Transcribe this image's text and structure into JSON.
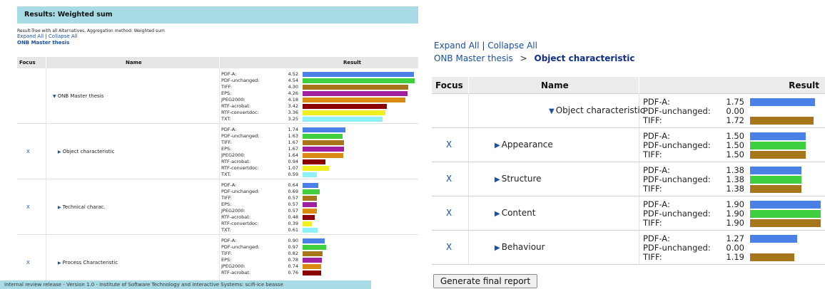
{
  "left": {
    "title": "Results: Weighted sum",
    "subtitle": "Result-Tree with all Alternatives, Aggregation method: Weighted sum",
    "expand_all": "Expand All",
    "link_sep": "|",
    "collapse_all": "Collapse All",
    "breadcrumb": "ONB Master thesis",
    "headers": {
      "focus": "Focus",
      "name": "Name",
      "result": "Result"
    },
    "footer": "Internal review release - Version 1.0 - Institute of Software Technology and Interactive Systems: scifi-ice beasse",
    "rows": [
      {
        "focus": "",
        "name": "ONB Master thesis",
        "expanded": true,
        "results": [
          {
            "label": "PDF-A:",
            "value": "4.52",
            "num": 4.52,
            "color": "#4a80e8"
          },
          {
            "label": "PDF-unchanged:",
            "value": "4.54",
            "num": 4.54,
            "color": "#3fcf3f"
          },
          {
            "label": "TIFF:",
            "value": "4.30",
            "num": 4.3,
            "color": "#a8761a"
          },
          {
            "label": "EPS:",
            "value": "4.26",
            "num": 4.26,
            "color": "#a020a0"
          },
          {
            "label": "JPEG2000:",
            "value": "4.18",
            "num": 4.18,
            "color": "#d98a10"
          },
          {
            "label": "RTF-acrobat:",
            "value": "3.42",
            "num": 3.42,
            "color": "#8b0000"
          },
          {
            "label": "RTF-convertdoc:",
            "value": "3.36",
            "num": 3.36,
            "color": "#f0f020"
          },
          {
            "label": "TXT:",
            "value": "3.25",
            "num": 3.25,
            "color": "#8ef0f8"
          }
        ]
      },
      {
        "focus": "X",
        "name": "Object characteristic",
        "expanded": false,
        "results": [
          {
            "label": "PDF-A:",
            "value": "1.74",
            "num": 1.74,
            "color": "#4a80e8"
          },
          {
            "label": "PDF-unchanged:",
            "value": "1.63",
            "num": 1.63,
            "color": "#3fcf3f"
          },
          {
            "label": "TIFF:",
            "value": "1.67",
            "num": 1.67,
            "color": "#a8761a"
          },
          {
            "label": "EPS:",
            "value": "1.67",
            "num": 1.67,
            "color": "#a020a0"
          },
          {
            "label": "JPEG2000:",
            "value": "1.64",
            "num": 1.64,
            "color": "#d98a10"
          },
          {
            "label": "RTF-acrobat:",
            "value": "0.94",
            "num": 0.94,
            "color": "#8b0000"
          },
          {
            "label": "RTF-convertdoc:",
            "value": "1.07",
            "num": 1.07,
            "color": "#f0f020"
          },
          {
            "label": "TXT:",
            "value": "0.59",
            "num": 0.59,
            "color": "#8ef0f8"
          }
        ]
      },
      {
        "focus": "X",
        "name": "Technical charac.",
        "expanded": false,
        "results": [
          {
            "label": "PDF-A:",
            "value": "0.64",
            "num": 0.64,
            "color": "#4a80e8"
          },
          {
            "label": "PDF-unchanged:",
            "value": "0.69",
            "num": 0.69,
            "color": "#3fcf3f"
          },
          {
            "label": "TIFF:",
            "value": "0.57",
            "num": 0.57,
            "color": "#a8761a"
          },
          {
            "label": "EPS:",
            "value": "0.57",
            "num": 0.57,
            "color": "#a020a0"
          },
          {
            "label": "JPEG2000:",
            "value": "0.57",
            "num": 0.57,
            "color": "#d98a10"
          },
          {
            "label": "RTF-acrobat:",
            "value": "0.48",
            "num": 0.48,
            "color": "#8b0000"
          },
          {
            "label": "RTF-convertdoc:",
            "value": "0.39",
            "num": 0.39,
            "color": "#f0f020"
          },
          {
            "label": "TXT:",
            "value": "0.61",
            "num": 0.61,
            "color": "#8ef0f8"
          }
        ]
      },
      {
        "focus": "X",
        "name": "Process Characteristic",
        "expanded": false,
        "results": [
          {
            "label": "PDF-A:",
            "value": "0.90",
            "num": 0.9,
            "color": "#4a80e8"
          },
          {
            "label": "PDF-unchanged:",
            "value": "0.97",
            "num": 0.97,
            "color": "#3fcf3f"
          },
          {
            "label": "TIFF:",
            "value": "0.82",
            "num": 0.82,
            "color": "#a8761a"
          },
          {
            "label": "EPS:",
            "value": "0.78",
            "num": 0.78,
            "color": "#a020a0"
          },
          {
            "label": "JPEG2000:",
            "value": "0.74",
            "num": 0.74,
            "color": "#d98a10"
          },
          {
            "label": "RTF-acrobat:",
            "value": "0.76",
            "num": 0.76,
            "color": "#8b0000"
          }
        ]
      }
    ]
  },
  "right": {
    "expand_all": "Expand All",
    "link_sep": "|",
    "collapse_all": "Collapse All",
    "breadcrumb_root": "ONB Master thesis",
    "breadcrumb_sep": ">",
    "breadcrumb_current": "Object characteristic",
    "headers": {
      "focus": "Focus",
      "name": "Name",
      "result": "Result"
    },
    "generate_button": "Generate final report",
    "rows": [
      {
        "focus": "",
        "name": "Object characteristic",
        "expanded": true,
        "results": [
          {
            "label": "PDF-A:",
            "value": "1.75",
            "num": 1.75,
            "color": "#4a80e8"
          },
          {
            "label": "PDF-unchanged:",
            "value": "0.00",
            "num": 0.0,
            "color": "#3fcf3f"
          },
          {
            "label": "TIFF:",
            "value": "1.72",
            "num": 1.72,
            "color": "#a8761a"
          }
        ]
      },
      {
        "focus": "X",
        "name": "Appearance",
        "expanded": false,
        "results": [
          {
            "label": "PDF-A:",
            "value": "1.50",
            "num": 1.5,
            "color": "#4a80e8"
          },
          {
            "label": "PDF-unchanged:",
            "value": "1.50",
            "num": 1.5,
            "color": "#3fcf3f"
          },
          {
            "label": "TIFF:",
            "value": "1.50",
            "num": 1.5,
            "color": "#a8761a"
          }
        ]
      },
      {
        "focus": "X",
        "name": "Structure",
        "expanded": false,
        "results": [
          {
            "label": "PDF-A:",
            "value": "1.38",
            "num": 1.38,
            "color": "#4a80e8"
          },
          {
            "label": "PDF-unchanged:",
            "value": "1.38",
            "num": 1.38,
            "color": "#3fcf3f"
          },
          {
            "label": "TIFF:",
            "value": "1.38",
            "num": 1.38,
            "color": "#a8761a"
          }
        ]
      },
      {
        "focus": "X",
        "name": "Content",
        "expanded": false,
        "results": [
          {
            "label": "PDF-A:",
            "value": "1.90",
            "num": 1.9,
            "color": "#4a80e8"
          },
          {
            "label": "PDF-unchanged:",
            "value": "1.90",
            "num": 1.9,
            "color": "#3fcf3f"
          },
          {
            "label": "TIFF:",
            "value": "1.90",
            "num": 1.9,
            "color": "#a8761a"
          }
        ]
      },
      {
        "focus": "X",
        "name": "Behaviour",
        "expanded": false,
        "results": [
          {
            "label": "PDF-A:",
            "value": "1.27",
            "num": 1.27,
            "color": "#4a80e8"
          },
          {
            "label": "PDF-unchanged:",
            "value": "0.00",
            "num": 0.0,
            "color": "#3fcf3f"
          },
          {
            "label": "TIFF:",
            "value": "1.19",
            "num": 1.19,
            "color": "#a8761a"
          }
        ]
      }
    ]
  }
}
